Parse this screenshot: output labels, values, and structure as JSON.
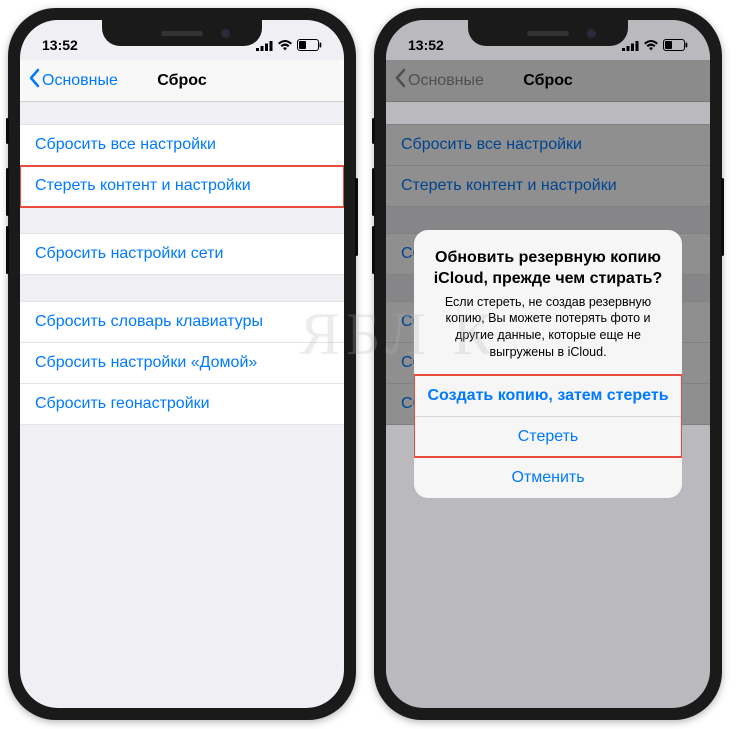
{
  "status": {
    "time": "13:52"
  },
  "nav": {
    "back_label": "Основные",
    "title": "Сброс"
  },
  "rows": {
    "reset_all": "Сбросить все настройки",
    "erase_content": "Стереть контент и настройки",
    "reset_network": "Сбросить настройки сети",
    "reset_keyboard": "Сбросить словарь клавиатуры",
    "reset_home": "Сбросить настройки «Домой»",
    "reset_location": "Сбросить геонастройки"
  },
  "alert": {
    "title": "Обновить резервную копию iCloud, прежде чем стирать?",
    "message": "Если стереть, не создав резервную копию, Вы можете потерять фото и другие данные, которые еще не выгружены в iCloud.",
    "backup_then_erase": "Создать копию, затем стереть",
    "erase": "Стереть",
    "cancel": "Отменить"
  },
  "highlight_color": "#e74c3c"
}
